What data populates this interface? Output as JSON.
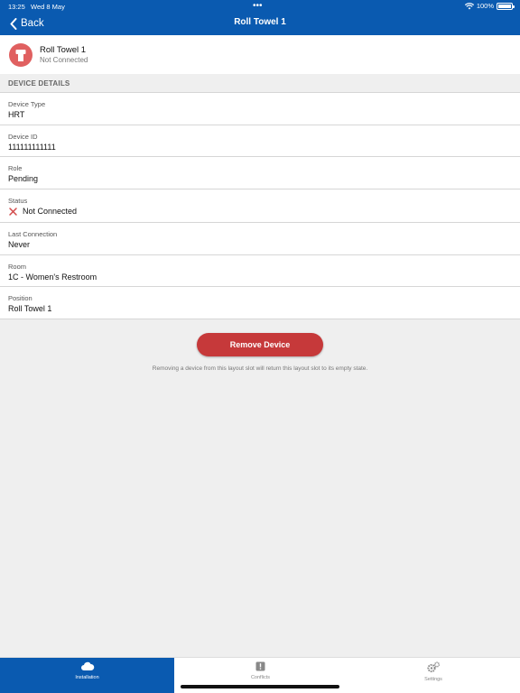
{
  "status_bar": {
    "time": "13:25",
    "date": "Wed 8 May",
    "dots": "•••",
    "battery": "100%"
  },
  "nav": {
    "back_label": "Back",
    "title": "Roll Towel 1"
  },
  "device": {
    "name": "Roll Towel 1",
    "status": "Not Connected",
    "avatar_color": "#e06060"
  },
  "details": {
    "section_title": "DEVICE DETAILS",
    "rows": [
      {
        "label": "Device Type",
        "value": "HRT"
      },
      {
        "label": "Device ID",
        "value": "111111111111"
      },
      {
        "label": "Role",
        "value": "Pending"
      },
      {
        "label": "Status",
        "value": "Not Connected"
      },
      {
        "label": "Last Connection",
        "value": "Never"
      },
      {
        "label": "Room",
        "value": "1C - Women's Restroom"
      },
      {
        "label": "Position",
        "value": "Roll Towel 1"
      }
    ]
  },
  "actions": {
    "remove_label": "Remove Device",
    "remove_note": "Removing a device from this layout slot will return this layout slot to its empty state."
  },
  "tabs": [
    {
      "label": "Installation",
      "icon": "cloud-icon",
      "active": true
    },
    {
      "label": "Conflicts",
      "icon": "alert-icon",
      "active": false
    },
    {
      "label": "Settings",
      "icon": "gears-icon",
      "active": false
    }
  ],
  "colors": {
    "brand": "#0a5ab0",
    "danger": "#c6393a"
  }
}
